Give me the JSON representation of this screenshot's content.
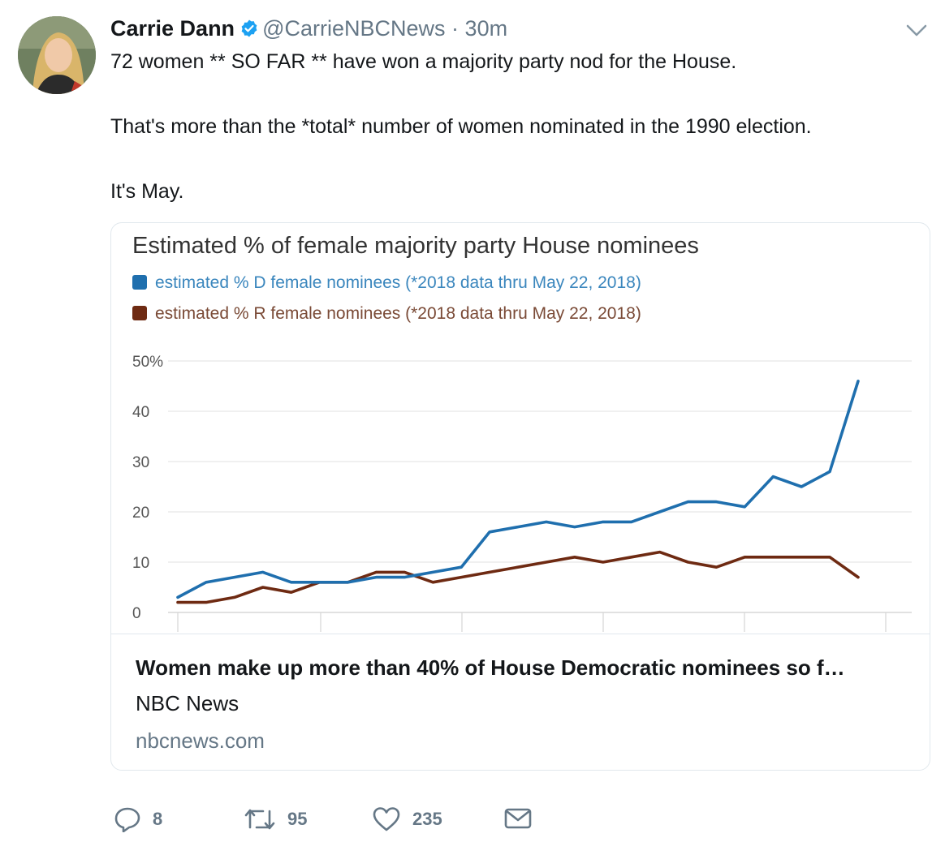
{
  "tweet": {
    "name": "Carrie Dann",
    "handle": "@CarrieNBCNews",
    "separator": "·",
    "time": "30m",
    "lines": [
      "72 women ** SO FAR ** have won a majority party nod for the House.",
      "That's more than the *total* number of women nominated in the 1990 election.",
      "It's May."
    ]
  },
  "card": {
    "title": "Women make up more than 40% of House Democratic nominees so f…",
    "publisher": "NBC News",
    "domain": "nbcnews.com"
  },
  "actions": {
    "replies": "8",
    "retweets": "95",
    "likes": "235"
  },
  "colors": {
    "dem": "#1f6fae",
    "rep": "#6e2a12",
    "verified": "#1da1f2"
  },
  "chart_data": {
    "type": "line",
    "title": "Estimated % of female majority party House nominees",
    "ylim": [
      0,
      50
    ],
    "y_ticks": [
      "50%",
      "40",
      "30",
      "20",
      "10",
      "0"
    ],
    "grid": true,
    "legend_position": "top-left",
    "series": [
      {
        "name": "estimated % D female nominees (*2018 data thru May 22, 2018)",
        "values": [
          3,
          6,
          7,
          8,
          6,
          6,
          6,
          7,
          7,
          8,
          9,
          16,
          17,
          18,
          17,
          18,
          18,
          20,
          22,
          22,
          21,
          27,
          25,
          28,
          46
        ]
      },
      {
        "name": "estimated % R female nominees (*2018 data thru May 22, 2018)",
        "values": [
          2,
          2,
          3,
          5,
          4,
          6,
          6,
          8,
          8,
          6,
          7,
          8,
          9,
          10,
          11,
          10,
          11,
          12,
          10,
          9,
          11,
          11,
          11,
          11,
          7
        ]
      }
    ]
  }
}
